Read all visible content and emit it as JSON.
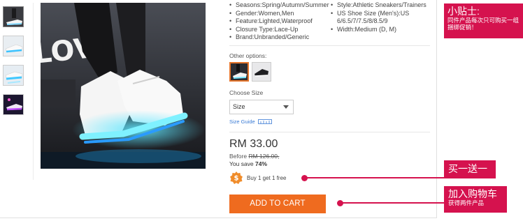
{
  "product": {
    "specs_left": [
      "Seasons:Spring/Autumn/Summer",
      "Gender:Women,Men",
      "Feature:Lighted,Waterproof",
      "Closure Type:Lace-Up",
      "Brand:Unbranded/Generic"
    ],
    "specs_right": [
      "Style:Athletic Sneakers/Trainers",
      "US Shoe Size (Men's):US 6/6.5/7/7.5/8/8.5/9",
      "Width:Medium (D, M)"
    ],
    "other_options_label": "Other options:",
    "choose_size_label": "Choose Size",
    "size_select": {
      "value": "Size"
    },
    "size_guide_label": "Size Guide",
    "price": "RM 33.00",
    "before_label": "Before",
    "before_price": "RM 126.00,",
    "save_label": "You save",
    "save_percent": "74%",
    "promo_text": "Buy 1 get 1 free",
    "add_to_cart_label": "ADD TO CART"
  },
  "annotations": {
    "tip_title": "小贴士:",
    "tip_body": "同件产品每次只可购买一组捆绑促销！",
    "buy_one_get_one": "买一送一",
    "add_cart_title": "加入购物车",
    "add_cart_sub": "获得两件产品"
  },
  "colors": {
    "accent_orange": "#ef6b1f",
    "callout_pink": "#d5124e",
    "link_blue": "#3a7bd5"
  }
}
